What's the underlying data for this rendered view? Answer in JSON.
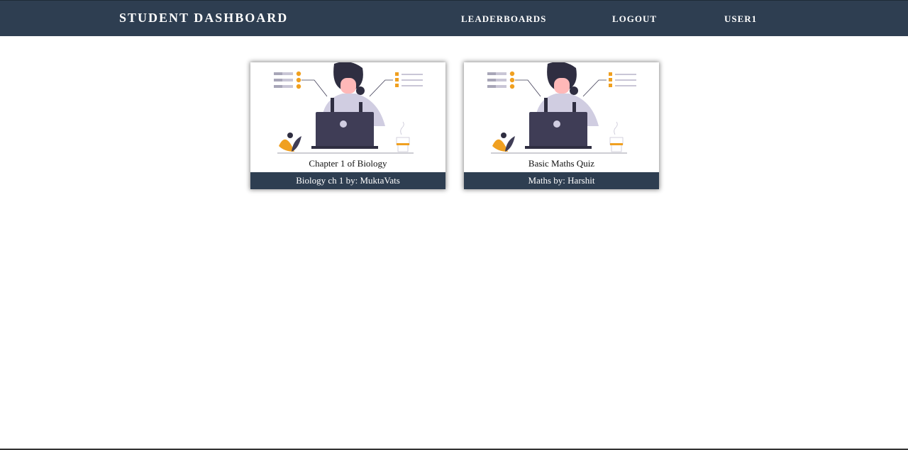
{
  "navbar": {
    "brand": "STUDENT DASHBOARD",
    "links": {
      "leaderboards": "LEADERBOARDS",
      "logout": "LOGOUT",
      "user": "USER1"
    }
  },
  "quizzes": [
    {
      "title": "Chapter 1 of Biology",
      "footer": "Biology ch 1 by: MuktaVats",
      "image_icon": "person-laptop-illustration"
    },
    {
      "title": "Basic Maths Quiz",
      "footer": "Maths by: Harshit",
      "image_icon": "person-laptop-illustration"
    }
  ],
  "colors": {
    "navbar": "#2e3e51",
    "accent": "#f0a020",
    "illustration_dark": "#3f3d56"
  }
}
